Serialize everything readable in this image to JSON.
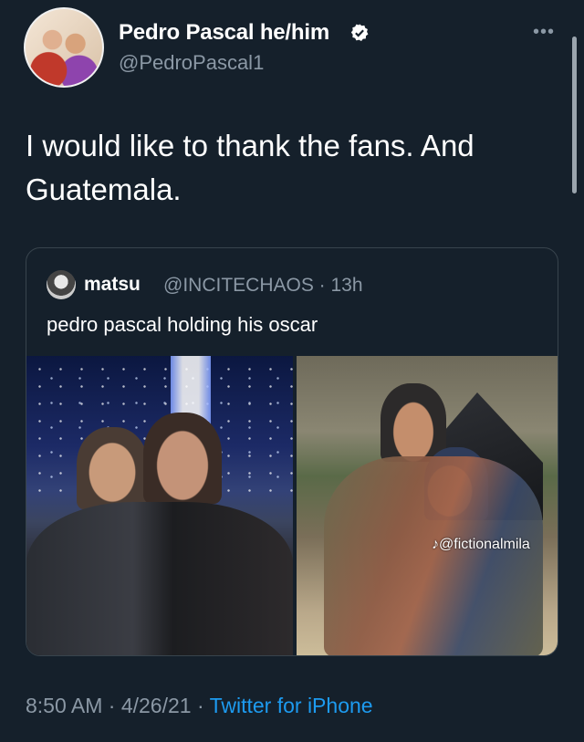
{
  "tweet": {
    "display_name": "Pedro Pascal he/him",
    "handle": "@PedroPascal1",
    "more_icon": "more-icon",
    "text": "I would like to thank the fans. And\nGuatemala.",
    "timestamp": "8:50 AM · 4/26/21 · ",
    "source": "Twitter for iPhone"
  },
  "quote": {
    "name": "matsu",
    "handle_time": "@INCITECHAOS · 13h",
    "text": "pedro pascal holding his oscar",
    "watermark": "♪@fictionalmila"
  },
  "colors": {
    "background": "#15202b",
    "secondary_text": "#8b98a5",
    "link": "#1d9bf0",
    "verified": "#ffffff"
  }
}
